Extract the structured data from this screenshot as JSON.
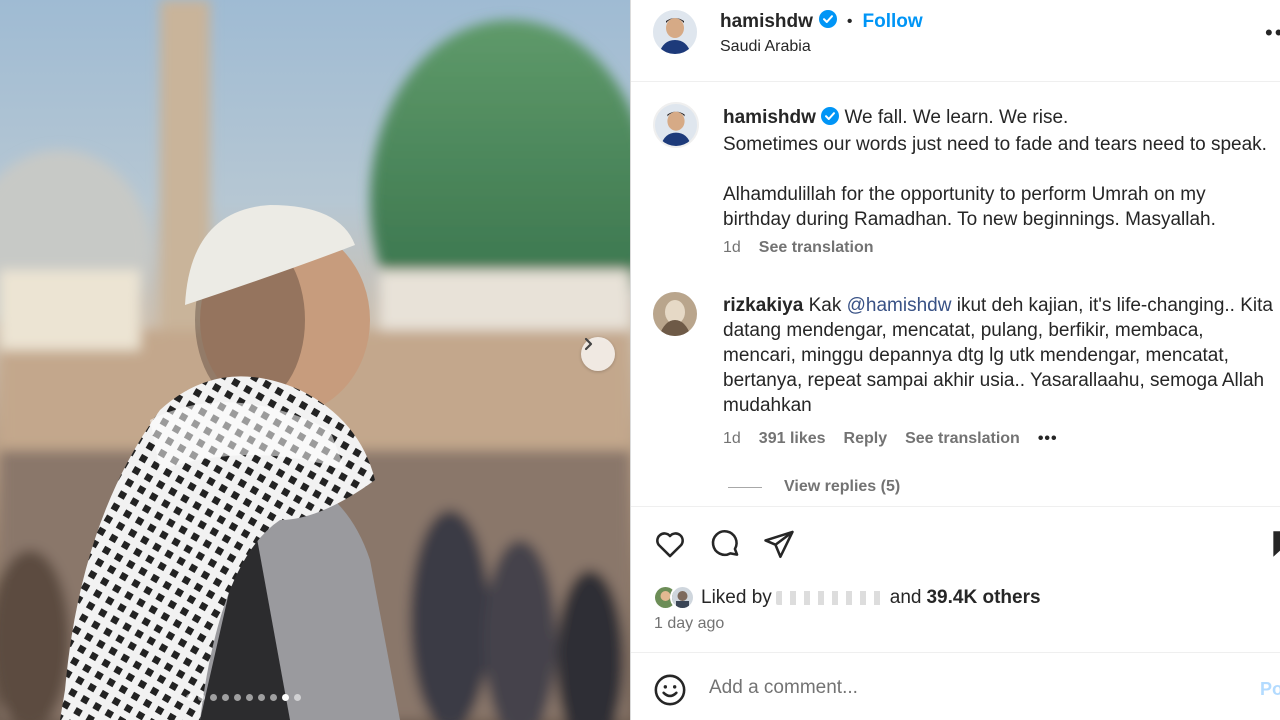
{
  "post": {
    "username": "hamishdw",
    "separator": "•",
    "follow_label": "Follow",
    "location": "Saudi Arabia",
    "more_label": "•••"
  },
  "media": {
    "slide_count": 10,
    "active_slide": 9,
    "next_icon": "chevron-right-icon"
  },
  "caption": {
    "username": "hamishdw",
    "line1": "We fall. We learn. We rise.",
    "line2": "Sometimes our words just need to fade and tears need to speak.",
    "paragraph2": "Alhamdulillah for the opportunity to perform Umrah on my birthday during Ramadhan. To new beginnings. Masyallah.",
    "time": "1d",
    "see_translation": "See translation"
  },
  "comment": {
    "username": "rizkakiya",
    "text_before": "Kak ",
    "mention": "@hamishdw",
    "text_after": " ikut deh kajian, it's life-changing.. Kita datang mendengar, mencatat, pulang, berfikir, membaca, mencari, minggu depannya dtg lg utk mendengar, mencatat, bertanya, repeat sampai akhir usia.. Yasarallaahu, semoga Allah mudahkan",
    "time": "1d",
    "likes": "391 likes",
    "reply": "Reply",
    "see_translation": "See translation",
    "more": "•••",
    "view_replies": "View replies (5)"
  },
  "actions": {
    "icons": [
      "heart-icon",
      "comment-icon",
      "share-icon",
      "bookmark-icon"
    ]
  },
  "likes": {
    "prefix": "Liked by",
    "and": "and",
    "others": "39.4K others",
    "time_ago": "1 day ago"
  },
  "comment_box": {
    "placeholder": "Add a comment...",
    "post_label": "Post"
  },
  "colors": {
    "accent": "#0095f6",
    "verified": "#0095f6",
    "mention": "#385185",
    "muted": "#737373"
  }
}
